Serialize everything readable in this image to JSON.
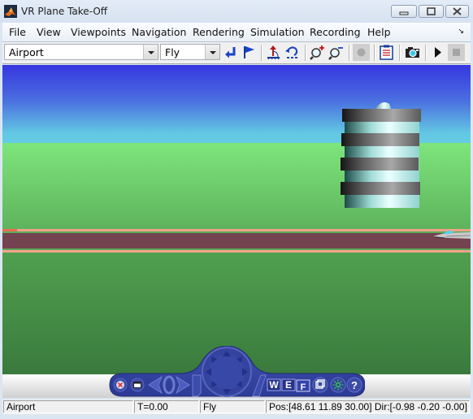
{
  "window": {
    "title": "VR Plane Take-Off",
    "controls": [
      "minimize",
      "maximize",
      "close"
    ]
  },
  "menu": {
    "items": [
      "File",
      "View",
      "Viewpoints",
      "Navigation",
      "Rendering",
      "Simulation",
      "Recording",
      "Help"
    ]
  },
  "toolbar": {
    "viewpoint_select": "Airport",
    "navigation_mode_select": "Fly",
    "buttons": [
      {
        "icon": "return-to-viewpoint-icon",
        "label": "Return to viewpoint"
      },
      {
        "icon": "create-viewpoint-flag-icon",
        "label": "Create viewpoint"
      },
      {
        "icon": "straighten-up-icon",
        "label": "Straighten up"
      },
      {
        "icon": "undo-move-icon",
        "label": "Undo move"
      },
      {
        "icon": "zoom-in-icon",
        "label": "Zoom in"
      },
      {
        "icon": "zoom-out-icon",
        "label": "Zoom out"
      },
      {
        "icon": "record-icon",
        "label": "Record"
      },
      {
        "icon": "capture-clipboard-icon",
        "label": "Capture"
      },
      {
        "icon": "camera-icon",
        "label": "Snapshot"
      },
      {
        "icon": "play-icon",
        "label": "Start simulation"
      },
      {
        "icon": "stop-icon",
        "label": "Stop simulation"
      }
    ]
  },
  "scene": {
    "colors": {
      "sky_top": "#3636e0",
      "sky_horizon": "#64cce3",
      "grass_far": "#7ee57c",
      "grass_near": "#3a7a3d",
      "runway": "#744350",
      "runway_stripe": "#f2a28b"
    }
  },
  "nav_panel": {
    "letters": [
      "W",
      "E",
      "F"
    ],
    "help_glyph": "?"
  },
  "status": {
    "viewpoint": "Airport",
    "time": "T=0.00",
    "mode": "Fly",
    "position": "Pos:[48.61 11.89 30.00] Dir:[-0.98 -0.20 -0.00]"
  }
}
